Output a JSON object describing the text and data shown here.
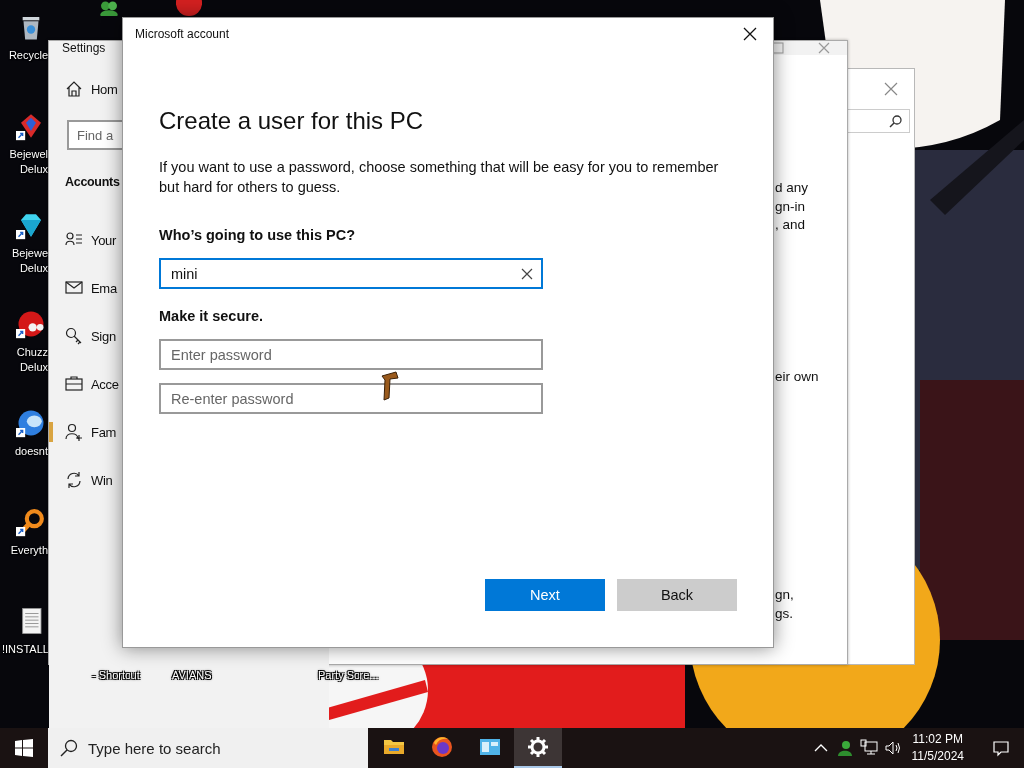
{
  "desktop": {
    "background": {
      "kind": "picture"
    },
    "icons": [
      {
        "label": "Recycle"
      },
      {
        "label": "Bejewel\nDelux"
      },
      {
        "label": "Bejewe\nDelux"
      },
      {
        "label": "Chuzz\nDelux"
      },
      {
        "label": "doesnt"
      },
      {
        "label": "Everyth"
      },
      {
        "label": "!INSTALL"
      }
    ],
    "bottom_labels": [
      "- Shortcut",
      "AVIANS",
      "Party Scre..."
    ]
  },
  "settings_window": {
    "title": "Settings",
    "home": "Hom",
    "search": {
      "placeholder": "Find a"
    },
    "section": "Accounts",
    "nav": [
      {
        "label": "Your",
        "selected": false
      },
      {
        "label": "Ema",
        "selected": false
      },
      {
        "label": "Sign",
        "selected": false
      },
      {
        "label": "Acce",
        "selected": false
      },
      {
        "label": "Fam",
        "selected": true
      },
      {
        "label": "Win",
        "selected": false
      }
    ],
    "content": [
      [
        "d any",
        "gn-in",
        ", and"
      ],
      [
        "eir own"
      ],
      [
        "gn,",
        "gs."
      ]
    ]
  },
  "dialog": {
    "title": "Microsoft account",
    "heading": "Create a user for this PC",
    "description": "If you want to use a password, choose something that will be easy for you to remember but hard for others to guess.",
    "name_label": "Who’s going to use this PC?",
    "name_field": {
      "value": "mini",
      "focused": true
    },
    "secure_label": "Make it secure.",
    "password_fields": [
      {
        "placeholder": "Enter password"
      },
      {
        "placeholder": "Re-enter password"
      }
    ],
    "buttons": [
      {
        "label": "Next",
        "kind": "primary"
      },
      {
        "label": "Back",
        "kind": "secondary"
      }
    ]
  },
  "taskbar": {
    "search": {
      "placeholder": "Type here to search"
    },
    "apps": [
      {
        "selected": false
      },
      {
        "selected": false
      },
      {
        "selected": false
      },
      {
        "selected": true
      }
    ],
    "time": "11:02 PM",
    "date": "11/5/2024"
  }
}
